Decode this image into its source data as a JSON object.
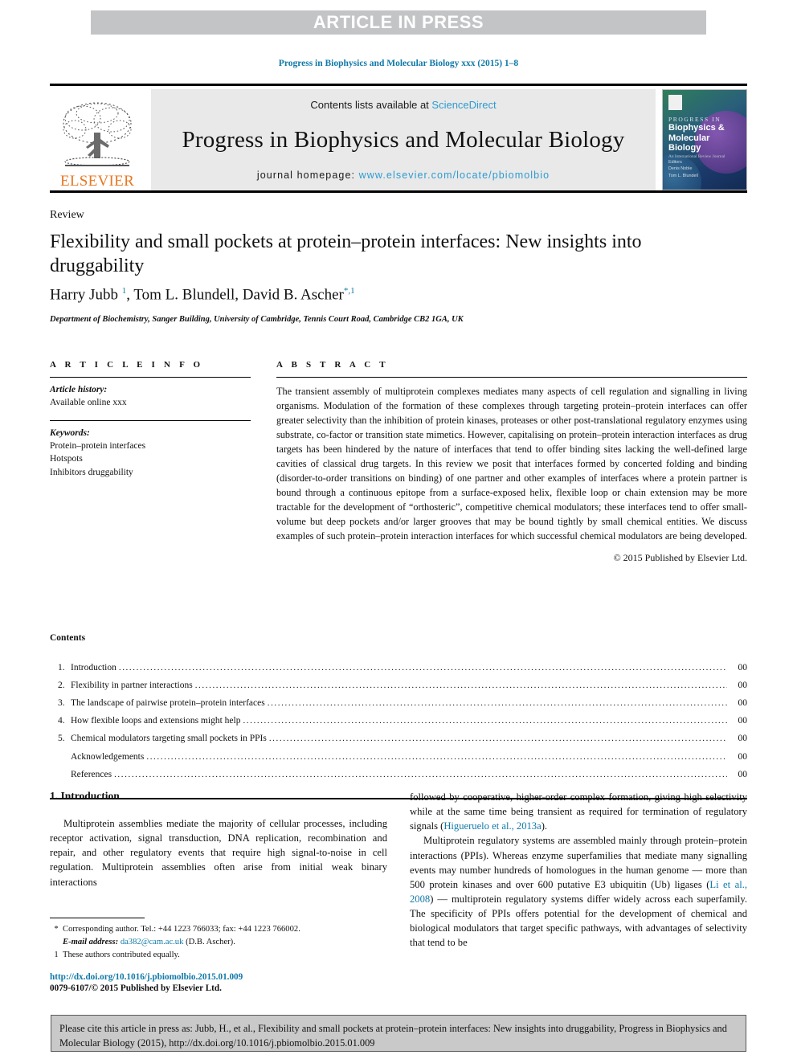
{
  "banner": {
    "text": "ARTICLE IN PRESS"
  },
  "running_head": "Progress in Biophysics and Molecular Biology xxx (2015) 1–8",
  "masthead": {
    "publisher_wordmark": "ELSEVIER",
    "contents_prefix": "Contents lists available at ",
    "contents_link": "ScienceDirect",
    "journal_title": "Progress in Biophysics and Molecular Biology",
    "homepage_prefix": "journal homepage: ",
    "homepage_url": "www.elsevier.com/locate/pbiomolbio",
    "cover": {
      "line1": "PROGRESS IN",
      "line2": "Biophysics &",
      "line3": "Molecular Biology",
      "tagline": "An International Review Journal",
      "editors_label": "Editors",
      "editor1": "Denis Noble",
      "editor2": "Tom L. Blundell"
    }
  },
  "article": {
    "section_type": "Review",
    "title": "Flexibility and small pockets at protein–protein interfaces: New insights into druggability",
    "authors_html": "Harry Jubb <sup>1</sup>, Tom L. Blundell, David B. Ascher<sup>*,1</sup>",
    "affiliation": "Department of Biochemistry, Sanger Building, University of Cambridge, Tennis Court Road, Cambridge CB2 1GA, UK"
  },
  "article_info": {
    "heading": "A R T I C L E   I N F O",
    "history_label": "Article history:",
    "history_value": "Available online xxx",
    "keywords_label": "Keywords:",
    "keywords": [
      "Protein–protein interfaces",
      "Hotspots",
      "Inhibitors druggability"
    ]
  },
  "abstract": {
    "heading": "A B S T R A C T",
    "body": "The transient assembly of multiprotein complexes mediates many aspects of cell regulation and signalling in living organisms. Modulation of the formation of these complexes through targeting protein–protein interfaces can offer greater selectivity than the inhibition of protein kinases, proteases or other post-translational regulatory enzymes using substrate, co-factor or transition state mimetics. However, capitalising on protein–protein interaction interfaces as drug targets has been hindered by the nature of interfaces that tend to offer binding sites lacking the well-defined large cavities of classical drug targets. In this review we posit that interfaces formed by concerted folding and binding (disorder-to-order transitions on binding) of one partner and other examples of interfaces where a protein partner is bound through a continuous epitope from a surface-exposed helix, flexible loop or chain extension may be more tractable for the development of “orthosteric”, competitive chemical modulators; these interfaces tend to offer small-volume but deep pockets and/or larger grooves that may be bound tightly by small chemical entities. We discuss examples of such protein–protein interaction interfaces for which successful chemical modulators are being developed.",
    "copyright": "© 2015 Published by Elsevier Ltd."
  },
  "contents": {
    "heading": "Contents",
    "items": [
      {
        "num": "1.",
        "label": "Introduction",
        "page": "00"
      },
      {
        "num": "2.",
        "label": "Flexibility in partner interactions",
        "page": "00"
      },
      {
        "num": "3.",
        "label": "The landscape of pairwise protein–protein interfaces",
        "page": "00"
      },
      {
        "num": "4.",
        "label": "How flexible loops and extensions might help",
        "page": "00"
      },
      {
        "num": "5.",
        "label": "Chemical modulators targeting small pockets in PPIs",
        "page": "00"
      },
      {
        "num": "",
        "label": "Acknowledgements",
        "page": "00"
      },
      {
        "num": "",
        "label": "References",
        "page": "00"
      }
    ]
  },
  "body": {
    "intro_heading": "1. Introduction",
    "left_p1": "Multiprotein assemblies mediate the majority of cellular processes, including receptor activation, signal transduction, DNA replication, recombination and repair, and other regulatory events that require high signal-to-noise in cell regulation. Multiprotein assemblies often arise from initial weak binary interactions",
    "right_p1_a": "followed by cooperative, higher-order complex formation, giving high selectivity while at the same time being transient as required for termination of regulatory signals (",
    "right_p1_ref": "Higueruelo et al., 2013a",
    "right_p1_b": ").",
    "right_p2_a": "Multiprotein regulatory systems are assembled mainly through protein–protein interactions (PPIs). Whereas enzyme superfamilies that mediate many signalling events may number hundreds of homologues in the human genome — more than 500 protein kinases and over 600 putative E3 ubiquitin (Ub) ligases (",
    "right_p2_ref": "Li et al., 2008",
    "right_p2_b": ") — multiprotein regulatory systems differ widely across each superfamily. The specificity of PPIs offers potential for the development of chemical and biological modulators that target specific pathways, with advantages of selectivity that tend to be"
  },
  "footnotes": {
    "corresponding_mark": "*",
    "corresponding": "Corresponding author. Tel.: +44 1223 766033; fax: +44 1223 766002.",
    "email_label": "E-mail address:",
    "email": "da382@cam.ac.uk",
    "email_suffix": "(D.B. Ascher).",
    "equal_mark": "1",
    "equal": "These authors contributed equally.",
    "doi": "http://dx.doi.org/10.1016/j.pbiomolbio.2015.01.009",
    "issn": "0079-6107/© 2015 Published by Elsevier Ltd."
  },
  "cite_box": {
    "text": "Please cite this article in press as: Jubb, H., et al., Flexibility and small pockets at protein–protein interfaces: New insights into druggability, Progress in Biophysics and Molecular Biology (2015), http://dx.doi.org/10.1016/j.pbiomolbio.2015.01.009"
  },
  "colors": {
    "link": "#1079a8",
    "sciencedirect": "#2e9bcf",
    "elsevier_orange": "#e87722",
    "banner_bg": "#c3c4c6",
    "masthead_bg": "#e9e9e9",
    "cite_bg": "#c9c9c9"
  }
}
